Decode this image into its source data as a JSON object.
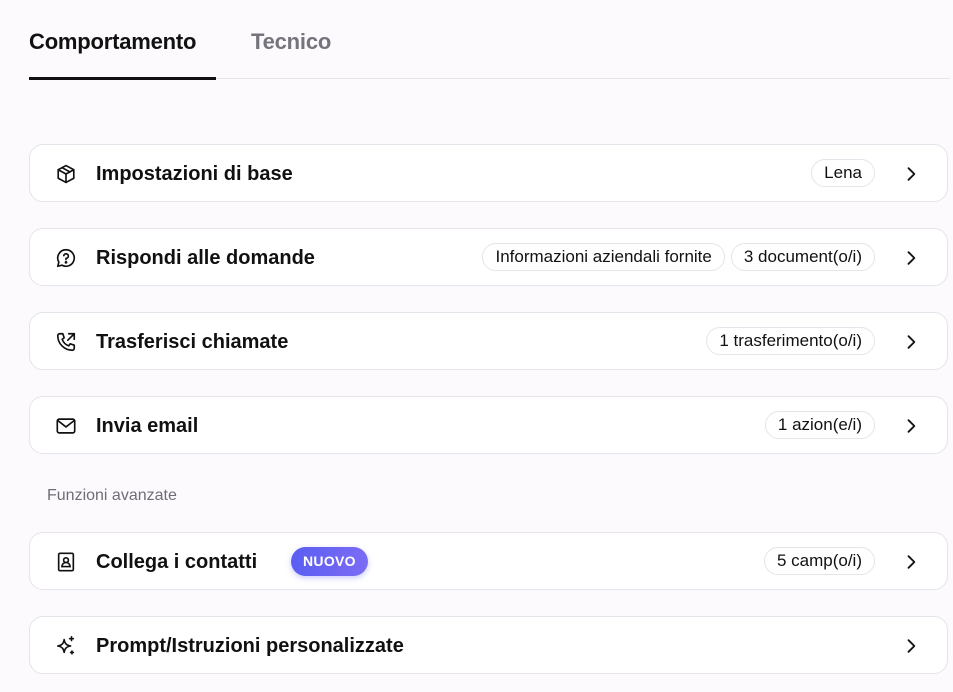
{
  "tabs": [
    {
      "label": "Comportamento",
      "active": true
    },
    {
      "label": "Tecnico",
      "active": false
    }
  ],
  "cards": {
    "basic": {
      "label": "Impostazioni di base",
      "pills": [
        "Lena"
      ]
    },
    "answer": {
      "label": "Rispondi alle domande",
      "pills": [
        "Informazioni aziendali fornite",
        "3 document(o/i)"
      ]
    },
    "transfer": {
      "label": "Trasferisci chiamate",
      "pills": [
        "1 trasferimento(o/i)"
      ]
    },
    "email": {
      "label": "Invia email",
      "pills": [
        "1 azion(e/i)"
      ]
    },
    "contacts": {
      "label": "Collega i contatti",
      "badge": "NUOVO",
      "pills": [
        "5 camp(o/i)"
      ]
    },
    "prompt": {
      "label": "Prompt/Istruzioni personalizzate",
      "pills": []
    }
  },
  "section": {
    "advanced_label": "Funzioni avanzate"
  },
  "icons": {
    "basic": "cube-icon",
    "answer": "chat-question-icon",
    "transfer": "phone-forward-icon",
    "email": "mail-icon",
    "contacts": "contact-book-icon",
    "prompt": "sparkle-icon",
    "chevron": "chevron-right-icon"
  },
  "colors": {
    "badge_start": "#5a5ef2",
    "badge_end": "#7c6cf4",
    "active_tab": "#111111",
    "inactive_tab": "#75737c"
  }
}
